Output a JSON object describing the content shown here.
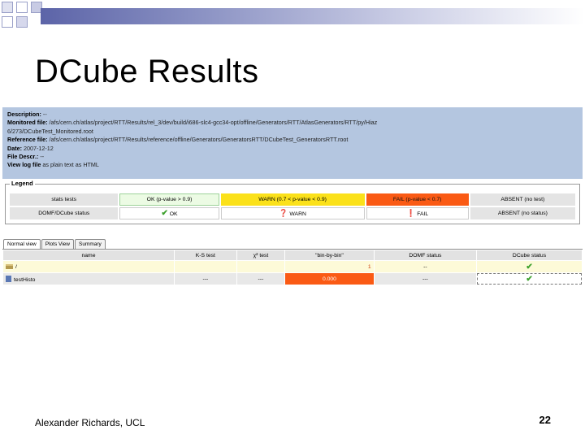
{
  "slide": {
    "title": "DCube Results",
    "footer_author": "Alexander Richards, UCL",
    "page_number": "22"
  },
  "description": {
    "rows": [
      {
        "label": "Description:",
        "value": " --"
      },
      {
        "label": "Monitored file:",
        "value": " /afs/cern.ch/atlas/project/RTT/Results/rel_3/dev/build/i686-slc4-gcc34-opt/offline/Generators/RTT/AtlasGenerators/RTT/py/Hiaz"
      },
      {
        "label": "",
        "value": "6/273/DCubeTest_Monitored.root"
      },
      {
        "label": "Reference file:",
        "value": " /afs/cern.ch/atlas/project/RTT/Results/reference/offline/Generators/GeneratorsRTT/DCubeTest_GeneratorsRTT.root"
      },
      {
        "label": "Date:",
        "value": " 2007-12-12"
      },
      {
        "label": "File Descr.:",
        "value": " --"
      },
      {
        "label": "View log file",
        "value": " as plain text as HTML"
      }
    ]
  },
  "legend": {
    "label": "Legend",
    "row1": [
      "stats tests",
      "OK (p-value > 0.9)",
      "WARN (0.7 < p-value < 0.9)",
      "FAIL (p-value < 0.7)",
      "ABSENT (no test)"
    ],
    "row2": [
      "DOMF/DCube status",
      "OK",
      "WARN",
      "FAIL",
      "ABSENT (no status)"
    ],
    "icons": {
      "ok": "✔",
      "warn": "❓",
      "fail": "❗"
    }
  },
  "tabs": [
    "Normal view",
    "Plots View",
    "Summary"
  ],
  "results": {
    "headers": [
      "name",
      "K-S test",
      "χ² test",
      "\"bin-by-bin\"",
      "DOMF status",
      "DCube status"
    ],
    "rows": [
      {
        "name": "/",
        "ks": "",
        "chi2": "",
        "bbb": "1",
        "domf": "--",
        "dcube": "✔"
      },
      {
        "name": "testHisto",
        "ks": "---",
        "chi2": "---",
        "bbb": "0.000",
        "domf": "---",
        "dcube": "✔"
      }
    ]
  },
  "colors": {
    "ok": "#ecfbe4",
    "warn": "#fbe11a",
    "fail": "#fa5a14",
    "header_bg": "#b4c6e0",
    "title_bar": "#5c64a8"
  }
}
